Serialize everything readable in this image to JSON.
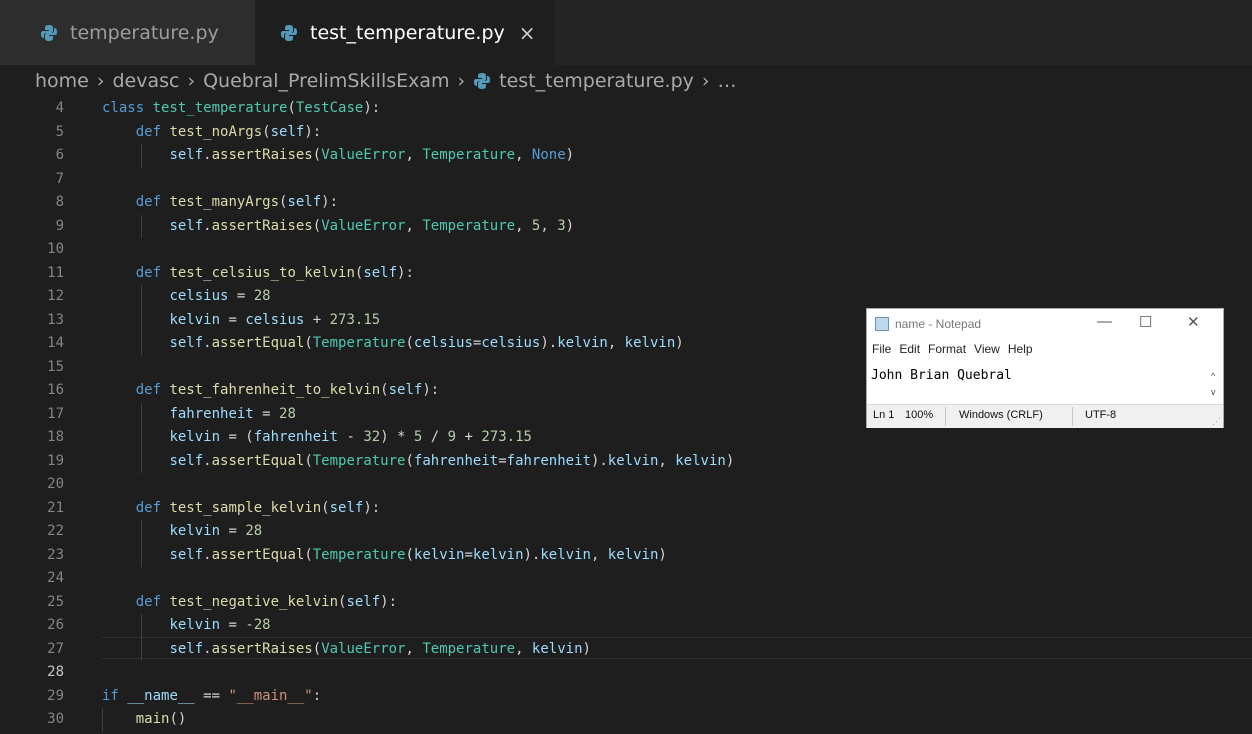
{
  "tabs": [
    {
      "label": "temperature.py",
      "active": false,
      "icon": "python-icon"
    },
    {
      "label": "test_temperature.py",
      "active": true,
      "icon": "python-icon"
    }
  ],
  "tab_close_glyph": "×",
  "breadcrumb": [
    "home",
    "devasc",
    "Quebral_PrelimSkillsExam",
    "test_temperature.py",
    "…"
  ],
  "breadcrumb_sep": "›",
  "editor": {
    "current_line": "28",
    "lines": [
      {
        "n": "4",
        "tokens": [
          [
            "k",
            "class "
          ],
          [
            "c",
            "test_temperature"
          ],
          [
            "t",
            "("
          ],
          [
            "c",
            "TestCase"
          ],
          [
            "t",
            "):"
          ]
        ]
      },
      {
        "n": "5",
        "tokens": [
          [
            "t",
            "    "
          ],
          [
            "k",
            "def "
          ],
          [
            "f",
            "test_noArgs"
          ],
          [
            "t",
            "("
          ],
          [
            "v",
            "self"
          ],
          [
            "t",
            "):"
          ]
        ]
      },
      {
        "n": "6",
        "tokens": [
          [
            "t",
            "        "
          ],
          [
            "v",
            "self"
          ],
          [
            "t",
            "."
          ],
          [
            "f",
            "assertRaises"
          ],
          [
            "t",
            "("
          ],
          [
            "c",
            "ValueError"
          ],
          [
            "t",
            ", "
          ],
          [
            "c",
            "Temperature"
          ],
          [
            "t",
            ", "
          ],
          [
            "k",
            "None"
          ],
          [
            "t",
            ")"
          ]
        ]
      },
      {
        "n": "7",
        "tokens": []
      },
      {
        "n": "8",
        "tokens": [
          [
            "t",
            "    "
          ],
          [
            "k",
            "def "
          ],
          [
            "f",
            "test_manyArgs"
          ],
          [
            "t",
            "("
          ],
          [
            "v",
            "self"
          ],
          [
            "t",
            "):"
          ]
        ]
      },
      {
        "n": "9",
        "tokens": [
          [
            "t",
            "        "
          ],
          [
            "v",
            "self"
          ],
          [
            "t",
            "."
          ],
          [
            "f",
            "assertRaises"
          ],
          [
            "t",
            "("
          ],
          [
            "c",
            "ValueError"
          ],
          [
            "t",
            ", "
          ],
          [
            "c",
            "Temperature"
          ],
          [
            "t",
            ", "
          ],
          [
            "n",
            "5"
          ],
          [
            "t",
            ", "
          ],
          [
            "n",
            "3"
          ],
          [
            "t",
            ")"
          ]
        ]
      },
      {
        "n": "10",
        "tokens": []
      },
      {
        "n": "11",
        "tokens": [
          [
            "t",
            "    "
          ],
          [
            "k",
            "def "
          ],
          [
            "f",
            "test_celsius_to_kelvin"
          ],
          [
            "t",
            "("
          ],
          [
            "v",
            "self"
          ],
          [
            "t",
            "):"
          ]
        ]
      },
      {
        "n": "12",
        "tokens": [
          [
            "t",
            "        "
          ],
          [
            "v",
            "celsius"
          ],
          [
            "t",
            " = "
          ],
          [
            "n",
            "28"
          ]
        ]
      },
      {
        "n": "13",
        "tokens": [
          [
            "t",
            "        "
          ],
          [
            "v",
            "kelvin"
          ],
          [
            "t",
            " = "
          ],
          [
            "v",
            "celsius"
          ],
          [
            "t",
            " + "
          ],
          [
            "n",
            "273.15"
          ]
        ]
      },
      {
        "n": "14",
        "tokens": [
          [
            "t",
            "        "
          ],
          [
            "v",
            "self"
          ],
          [
            "t",
            "."
          ],
          [
            "f",
            "assertEqual"
          ],
          [
            "t",
            "("
          ],
          [
            "c",
            "Temperature"
          ],
          [
            "t",
            "("
          ],
          [
            "v",
            "celsius"
          ],
          [
            "t",
            "="
          ],
          [
            "v",
            "celsius"
          ],
          [
            "t",
            ")."
          ],
          [
            "v",
            "kelvin"
          ],
          [
            "t",
            ", "
          ],
          [
            "v",
            "kelvin"
          ],
          [
            "t",
            ")"
          ]
        ]
      },
      {
        "n": "15",
        "tokens": []
      },
      {
        "n": "16",
        "tokens": [
          [
            "t",
            "    "
          ],
          [
            "k",
            "def "
          ],
          [
            "f",
            "test_fahrenheit_to_kelvin"
          ],
          [
            "t",
            "("
          ],
          [
            "v",
            "self"
          ],
          [
            "t",
            "):"
          ]
        ]
      },
      {
        "n": "17",
        "tokens": [
          [
            "t",
            "        "
          ],
          [
            "v",
            "fahrenheit"
          ],
          [
            "t",
            " = "
          ],
          [
            "n",
            "28"
          ]
        ]
      },
      {
        "n": "18",
        "tokens": [
          [
            "t",
            "        "
          ],
          [
            "v",
            "kelvin"
          ],
          [
            "t",
            " = ("
          ],
          [
            "v",
            "fahrenheit"
          ],
          [
            "t",
            " - "
          ],
          [
            "n",
            "32"
          ],
          [
            "t",
            ") * "
          ],
          [
            "n",
            "5"
          ],
          [
            "t",
            " / "
          ],
          [
            "n",
            "9"
          ],
          [
            "t",
            " + "
          ],
          [
            "n",
            "273.15"
          ]
        ]
      },
      {
        "n": "19",
        "tokens": [
          [
            "t",
            "        "
          ],
          [
            "v",
            "self"
          ],
          [
            "t",
            "."
          ],
          [
            "f",
            "assertEqual"
          ],
          [
            "t",
            "("
          ],
          [
            "c",
            "Temperature"
          ],
          [
            "t",
            "("
          ],
          [
            "v",
            "fahrenheit"
          ],
          [
            "t",
            "="
          ],
          [
            "v",
            "fahrenheit"
          ],
          [
            "t",
            ")."
          ],
          [
            "v",
            "kelvin"
          ],
          [
            "t",
            ", "
          ],
          [
            "v",
            "kelvin"
          ],
          [
            "t",
            ")"
          ]
        ]
      },
      {
        "n": "20",
        "tokens": []
      },
      {
        "n": "21",
        "tokens": [
          [
            "t",
            "    "
          ],
          [
            "k",
            "def "
          ],
          [
            "f",
            "test_sample_kelvin"
          ],
          [
            "t",
            "("
          ],
          [
            "v",
            "self"
          ],
          [
            "t",
            "):"
          ]
        ]
      },
      {
        "n": "22",
        "tokens": [
          [
            "t",
            "        "
          ],
          [
            "v",
            "kelvin"
          ],
          [
            "t",
            " = "
          ],
          [
            "n",
            "28"
          ]
        ]
      },
      {
        "n": "23",
        "tokens": [
          [
            "t",
            "        "
          ],
          [
            "v",
            "self"
          ],
          [
            "t",
            "."
          ],
          [
            "f",
            "assertEqual"
          ],
          [
            "t",
            "("
          ],
          [
            "c",
            "Temperature"
          ],
          [
            "t",
            "("
          ],
          [
            "v",
            "kelvin"
          ],
          [
            "t",
            "="
          ],
          [
            "v",
            "kelvin"
          ],
          [
            "t",
            ")."
          ],
          [
            "v",
            "kelvin"
          ],
          [
            "t",
            ", "
          ],
          [
            "v",
            "kelvin"
          ],
          [
            "t",
            ")"
          ]
        ]
      },
      {
        "n": "24",
        "tokens": []
      },
      {
        "n": "25",
        "tokens": [
          [
            "t",
            "    "
          ],
          [
            "k",
            "def "
          ],
          [
            "f",
            "test_negative_kelvin"
          ],
          [
            "t",
            "("
          ],
          [
            "v",
            "self"
          ],
          [
            "t",
            "):"
          ]
        ]
      },
      {
        "n": "26",
        "tokens": [
          [
            "t",
            "        "
          ],
          [
            "v",
            "kelvin"
          ],
          [
            "t",
            " = "
          ],
          [
            "n",
            "-28"
          ]
        ]
      },
      {
        "n": "27",
        "tokens": [
          [
            "t",
            "        "
          ],
          [
            "v",
            "self"
          ],
          [
            "t",
            "."
          ],
          [
            "f",
            "assertRaises"
          ],
          [
            "t",
            "("
          ],
          [
            "c",
            "ValueError"
          ],
          [
            "t",
            ", "
          ],
          [
            "c",
            "Temperature"
          ],
          [
            "t",
            ", "
          ],
          [
            "v",
            "kelvin"
          ],
          [
            "t",
            ")"
          ]
        ]
      },
      {
        "n": "28",
        "tokens": []
      },
      {
        "n": "29",
        "tokens": [
          [
            "k",
            "if "
          ],
          [
            "v",
            "__name__"
          ],
          [
            "t",
            " == "
          ],
          [
            "s",
            "\"__main__\""
          ],
          [
            "t",
            ":"
          ]
        ]
      },
      {
        "n": "30",
        "tokens": [
          [
            "t",
            "    "
          ],
          [
            "f",
            "main"
          ],
          [
            "t",
            "()"
          ]
        ]
      }
    ]
  },
  "notepad": {
    "title": "name - Notepad",
    "window_buttons": {
      "minimize": "—",
      "maximize": "☐",
      "close": "✕"
    },
    "menu": [
      "File",
      "Edit",
      "Format",
      "View",
      "Help"
    ],
    "text": "John Brian Quebral",
    "scroll_up": "^",
    "scroll_down": "v",
    "status": {
      "position": "Ln 1",
      "zoom": "100%",
      "line_ending": "Windows (CRLF)",
      "encoding": "UTF-8"
    }
  },
  "colors": {
    "keyword": "#569cd6",
    "function": "#dcdcaa",
    "class": "#4ec9b0",
    "variable": "#9cdcfe",
    "number": "#b5cea8",
    "string": "#ce9178",
    "python_icon": "#519aba"
  }
}
